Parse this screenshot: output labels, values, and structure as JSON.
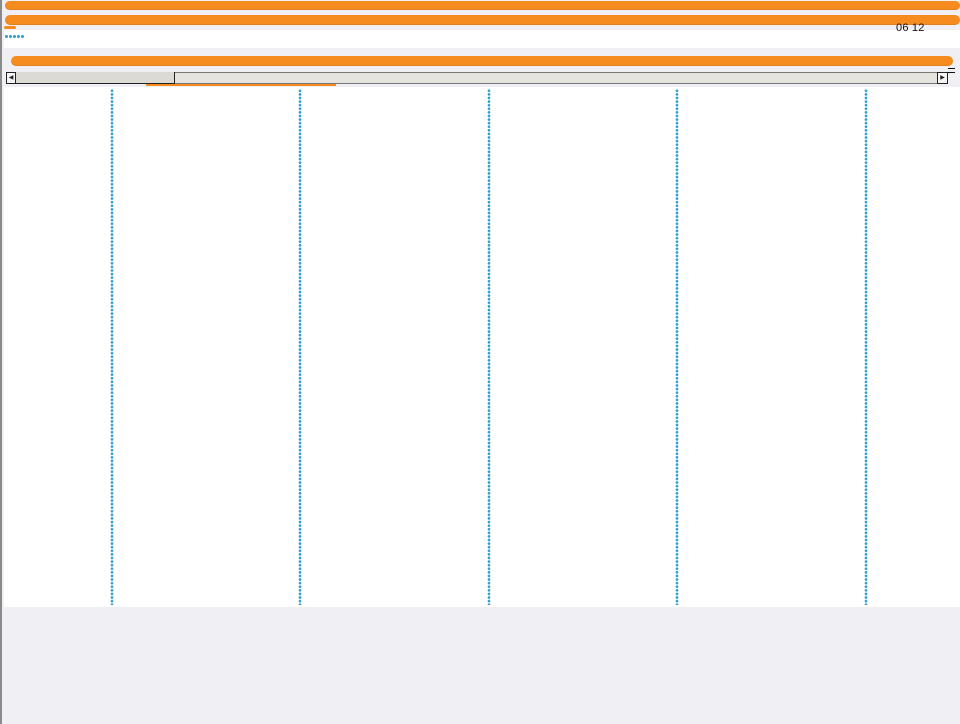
{
  "header": {
    "bar1_label": "",
    "bar2_label": "",
    "clock": "06 12"
  },
  "rating": {
    "count": 5,
    "caption": "",
    "caption2": ""
  },
  "scroll": {
    "left_arrow": "◀",
    "right_arrow": "▶"
  },
  "table": {
    "columns": 5,
    "row_label": ""
  },
  "footer": {
    "text": "",
    "text2": ""
  },
  "colors": {
    "accent": "#f68b1f",
    "dots": "#2f9fd2"
  }
}
